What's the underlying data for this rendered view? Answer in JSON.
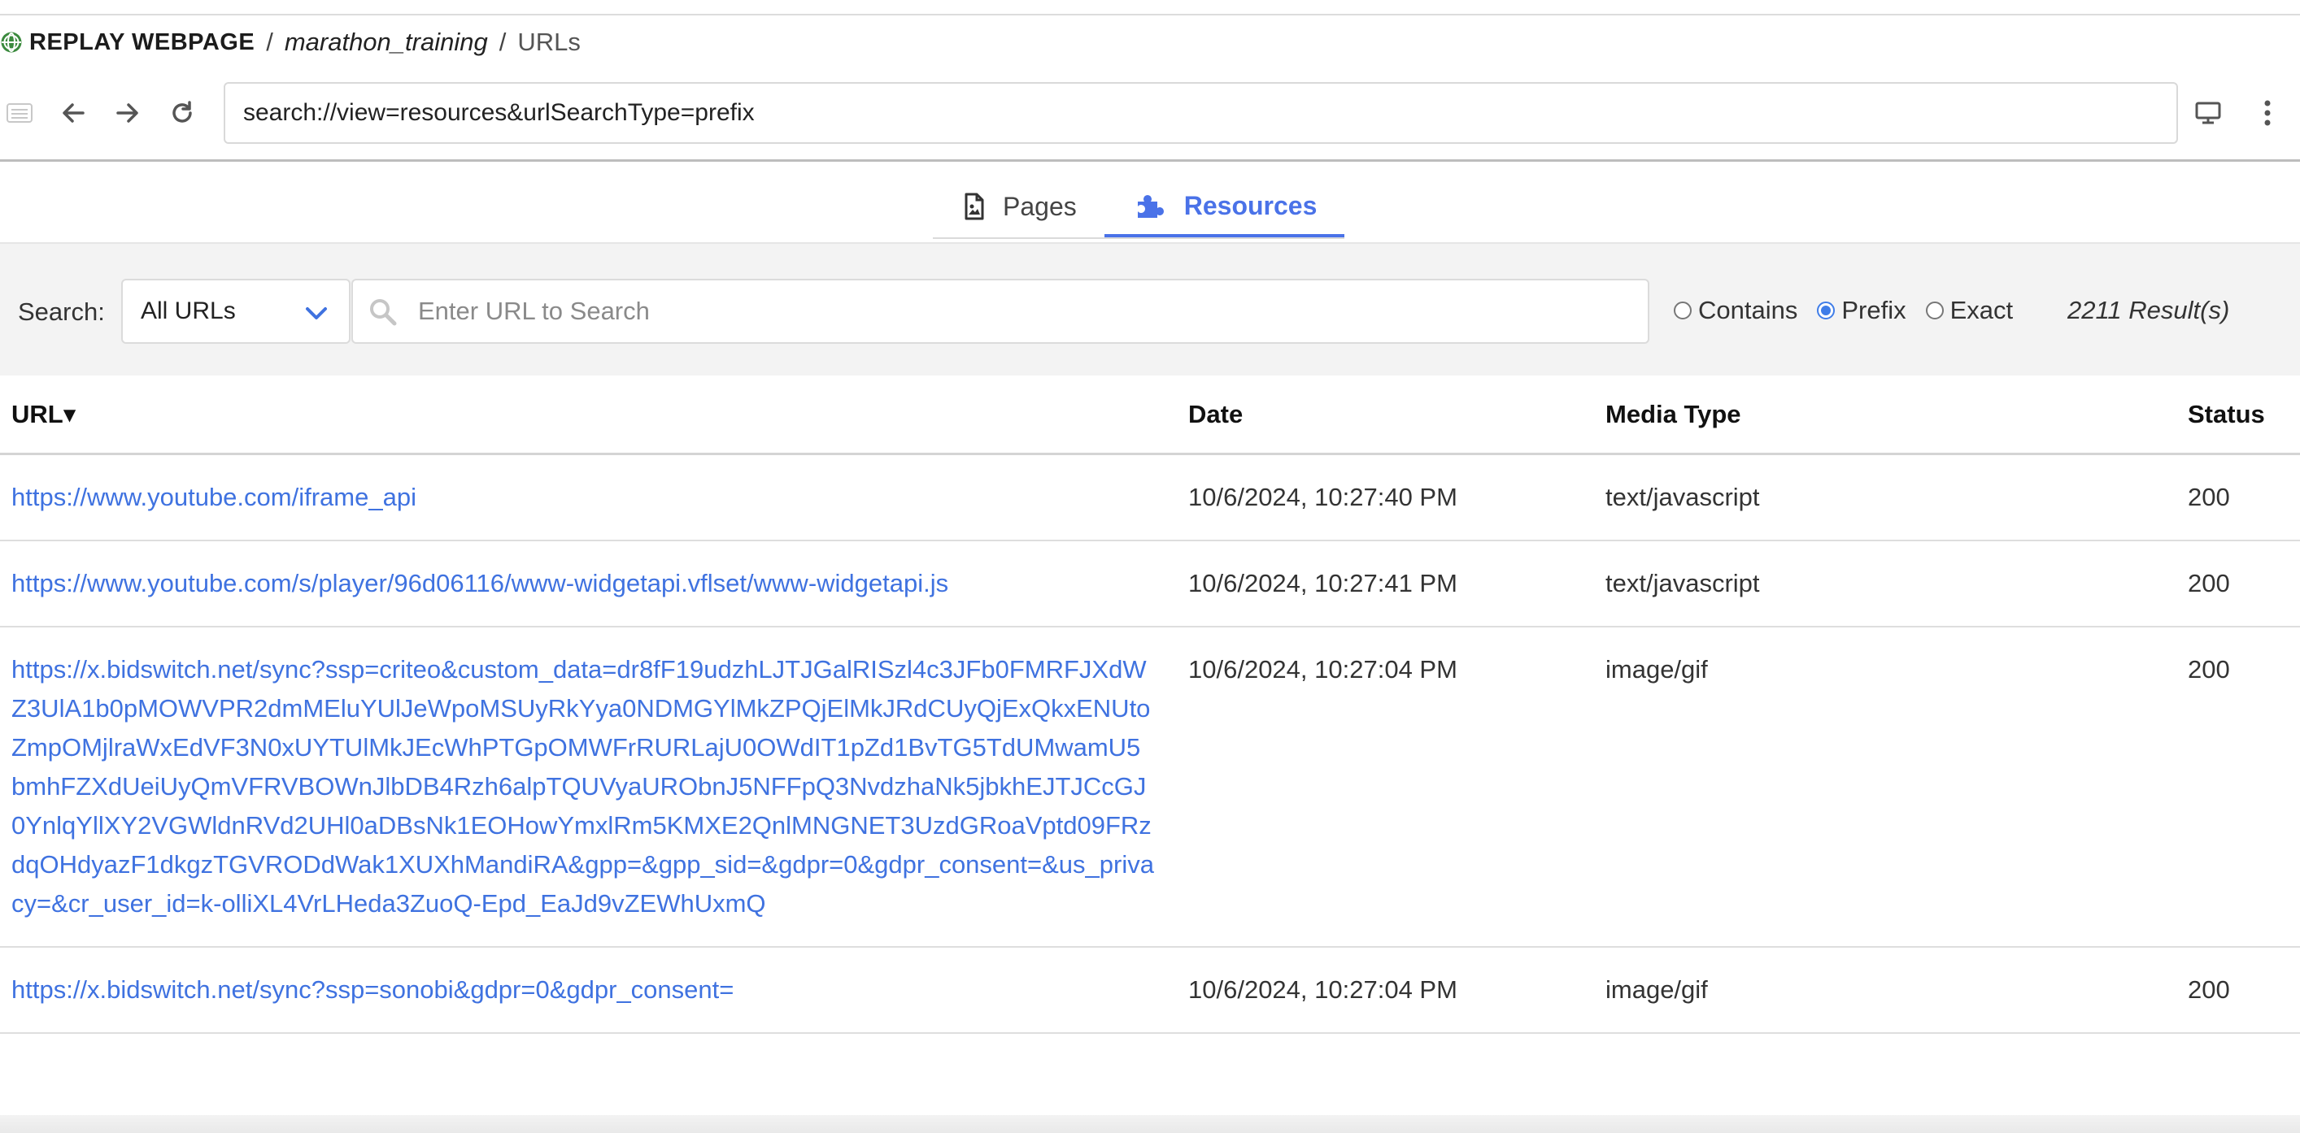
{
  "breadcrumb": {
    "brand": "REPLAY WEBPAGE",
    "separator": "/",
    "collection": "marathon_training",
    "current": "URLs"
  },
  "toolbar": {
    "url": "search://view=resources&urlSearchType=prefix",
    "icons": [
      "sidebar-icon",
      "back-arrow-icon",
      "forward-arrow-icon",
      "reload-icon",
      "desktop-icon",
      "more-vertical-icon"
    ]
  },
  "tabs": [
    {
      "label": "Pages",
      "icon": "document-icon",
      "active": false
    },
    {
      "label": "Resources",
      "icon": "puzzle-icon",
      "active": true
    }
  ],
  "search": {
    "label": "Search:",
    "select_value": "All URLs",
    "placeholder": "Enter URL to Search",
    "options": [
      {
        "label": "Contains",
        "checked": false
      },
      {
        "label": "Prefix",
        "checked": true
      },
      {
        "label": "Exact",
        "checked": false
      }
    ],
    "results": "2211 Result(s)"
  },
  "table": {
    "headers": [
      "URL▾",
      "Date",
      "Media Type",
      "Status"
    ],
    "rows": [
      {
        "url": "https://www.youtube.com/iframe_api",
        "date": "10/6/2024, 10:27:40 PM",
        "media": "text/javascript",
        "status": "200"
      },
      {
        "url": "https://www.youtube.com/s/player/96d06116/www-widgetapi.vflset/www-widgetapi.js",
        "date": "10/6/2024, 10:27:41 PM",
        "media": "text/javascript",
        "status": "200"
      },
      {
        "url": "https://x.bidswitch.net/sync?ssp=criteo&custom_data=dr8fF19udzhLJTJGalRISzl4c3JFb0FMRFJXdWZ3UlA1b0pMOWVPR2dmMEluYUlJeWpoMSUyRkYya0NDMGYlMkZPQjElMkJRdCUyQjExQkxENUtoZmpOMjlraWxEdVF3N0xUYTUlMkJEcWhPTGpOMWFrRURLajU0OWdIT1pZd1BvTG5TdUMwamU5bmhFZXdUeiUyQmVFRVBOWnJlbDB4Rzh6alpTQUVyaURObnJ5NFFpQ3NvdzhaNk5jbkhEJTJCcGJ0YnlqYllXY2VGWldnRVd2UHl0aDBsNk1EOHowYmxlRm5KMXE2QnlMNGNET3UzdGRoaVptd09FRzdqOHdyazF1dkgzTGVRODdWak1XUXhMandiRA&gpp=&gpp_sid=&gdpr=0&gdpr_consent=&us_privacy=&cr_user_id=k-olliXL4VrLHeda3ZuoQ-Epd_EaJd9vZEWhUxmQ",
        "date": "10/6/2024, 10:27:04 PM",
        "media": "image/gif",
        "status": "200"
      },
      {
        "url": "https://x.bidswitch.net/sync?ssp=sonobi&gdpr=0&gdpr_consent=",
        "date": "10/6/2024, 10:27:04 PM",
        "media": "image/gif",
        "status": "200"
      }
    ]
  }
}
